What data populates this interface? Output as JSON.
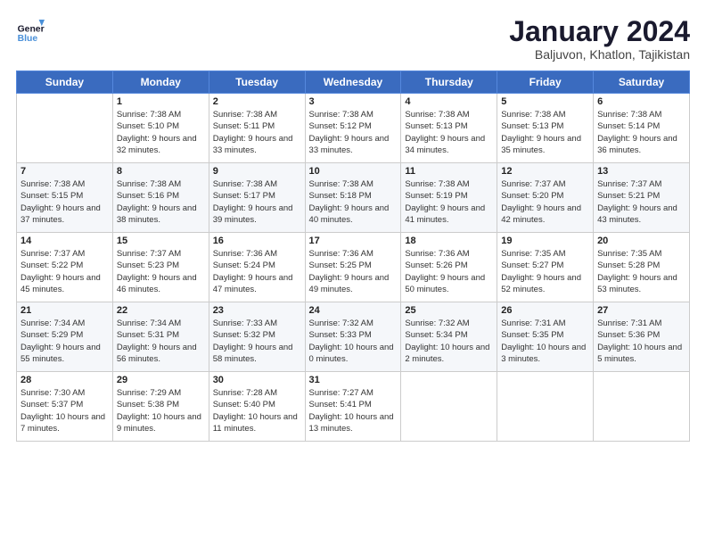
{
  "logo": {
    "line1": "General",
    "line2": "Blue"
  },
  "title": "January 2024",
  "subtitle": "Baljuvon, Khatlon, Tajikistan",
  "days_of_week": [
    "Sunday",
    "Monday",
    "Tuesday",
    "Wednesday",
    "Thursday",
    "Friday",
    "Saturday"
  ],
  "weeks": [
    [
      {
        "day": "",
        "sunrise": "",
        "sunset": "",
        "daylight": ""
      },
      {
        "day": "1",
        "sunrise": "Sunrise: 7:38 AM",
        "sunset": "Sunset: 5:10 PM",
        "daylight": "Daylight: 9 hours and 32 minutes."
      },
      {
        "day": "2",
        "sunrise": "Sunrise: 7:38 AM",
        "sunset": "Sunset: 5:11 PM",
        "daylight": "Daylight: 9 hours and 33 minutes."
      },
      {
        "day": "3",
        "sunrise": "Sunrise: 7:38 AM",
        "sunset": "Sunset: 5:12 PM",
        "daylight": "Daylight: 9 hours and 33 minutes."
      },
      {
        "day": "4",
        "sunrise": "Sunrise: 7:38 AM",
        "sunset": "Sunset: 5:13 PM",
        "daylight": "Daylight: 9 hours and 34 minutes."
      },
      {
        "day": "5",
        "sunrise": "Sunrise: 7:38 AM",
        "sunset": "Sunset: 5:13 PM",
        "daylight": "Daylight: 9 hours and 35 minutes."
      },
      {
        "day": "6",
        "sunrise": "Sunrise: 7:38 AM",
        "sunset": "Sunset: 5:14 PM",
        "daylight": "Daylight: 9 hours and 36 minutes."
      }
    ],
    [
      {
        "day": "7",
        "sunrise": "Sunrise: 7:38 AM",
        "sunset": "Sunset: 5:15 PM",
        "daylight": "Daylight: 9 hours and 37 minutes."
      },
      {
        "day": "8",
        "sunrise": "Sunrise: 7:38 AM",
        "sunset": "Sunset: 5:16 PM",
        "daylight": "Daylight: 9 hours and 38 minutes."
      },
      {
        "day": "9",
        "sunrise": "Sunrise: 7:38 AM",
        "sunset": "Sunset: 5:17 PM",
        "daylight": "Daylight: 9 hours and 39 minutes."
      },
      {
        "day": "10",
        "sunrise": "Sunrise: 7:38 AM",
        "sunset": "Sunset: 5:18 PM",
        "daylight": "Daylight: 9 hours and 40 minutes."
      },
      {
        "day": "11",
        "sunrise": "Sunrise: 7:38 AM",
        "sunset": "Sunset: 5:19 PM",
        "daylight": "Daylight: 9 hours and 41 minutes."
      },
      {
        "day": "12",
        "sunrise": "Sunrise: 7:37 AM",
        "sunset": "Sunset: 5:20 PM",
        "daylight": "Daylight: 9 hours and 42 minutes."
      },
      {
        "day": "13",
        "sunrise": "Sunrise: 7:37 AM",
        "sunset": "Sunset: 5:21 PM",
        "daylight": "Daylight: 9 hours and 43 minutes."
      }
    ],
    [
      {
        "day": "14",
        "sunrise": "Sunrise: 7:37 AM",
        "sunset": "Sunset: 5:22 PM",
        "daylight": "Daylight: 9 hours and 45 minutes."
      },
      {
        "day": "15",
        "sunrise": "Sunrise: 7:37 AM",
        "sunset": "Sunset: 5:23 PM",
        "daylight": "Daylight: 9 hours and 46 minutes."
      },
      {
        "day": "16",
        "sunrise": "Sunrise: 7:36 AM",
        "sunset": "Sunset: 5:24 PM",
        "daylight": "Daylight: 9 hours and 47 minutes."
      },
      {
        "day": "17",
        "sunrise": "Sunrise: 7:36 AM",
        "sunset": "Sunset: 5:25 PM",
        "daylight": "Daylight: 9 hours and 49 minutes."
      },
      {
        "day": "18",
        "sunrise": "Sunrise: 7:36 AM",
        "sunset": "Sunset: 5:26 PM",
        "daylight": "Daylight: 9 hours and 50 minutes."
      },
      {
        "day": "19",
        "sunrise": "Sunrise: 7:35 AM",
        "sunset": "Sunset: 5:27 PM",
        "daylight": "Daylight: 9 hours and 52 minutes."
      },
      {
        "day": "20",
        "sunrise": "Sunrise: 7:35 AM",
        "sunset": "Sunset: 5:28 PM",
        "daylight": "Daylight: 9 hours and 53 minutes."
      }
    ],
    [
      {
        "day": "21",
        "sunrise": "Sunrise: 7:34 AM",
        "sunset": "Sunset: 5:29 PM",
        "daylight": "Daylight: 9 hours and 55 minutes."
      },
      {
        "day": "22",
        "sunrise": "Sunrise: 7:34 AM",
        "sunset": "Sunset: 5:31 PM",
        "daylight": "Daylight: 9 hours and 56 minutes."
      },
      {
        "day": "23",
        "sunrise": "Sunrise: 7:33 AM",
        "sunset": "Sunset: 5:32 PM",
        "daylight": "Daylight: 9 hours and 58 minutes."
      },
      {
        "day": "24",
        "sunrise": "Sunrise: 7:32 AM",
        "sunset": "Sunset: 5:33 PM",
        "daylight": "Daylight: 10 hours and 0 minutes."
      },
      {
        "day": "25",
        "sunrise": "Sunrise: 7:32 AM",
        "sunset": "Sunset: 5:34 PM",
        "daylight": "Daylight: 10 hours and 2 minutes."
      },
      {
        "day": "26",
        "sunrise": "Sunrise: 7:31 AM",
        "sunset": "Sunset: 5:35 PM",
        "daylight": "Daylight: 10 hours and 3 minutes."
      },
      {
        "day": "27",
        "sunrise": "Sunrise: 7:31 AM",
        "sunset": "Sunset: 5:36 PM",
        "daylight": "Daylight: 10 hours and 5 minutes."
      }
    ],
    [
      {
        "day": "28",
        "sunrise": "Sunrise: 7:30 AM",
        "sunset": "Sunset: 5:37 PM",
        "daylight": "Daylight: 10 hours and 7 minutes."
      },
      {
        "day": "29",
        "sunrise": "Sunrise: 7:29 AM",
        "sunset": "Sunset: 5:38 PM",
        "daylight": "Daylight: 10 hours and 9 minutes."
      },
      {
        "day": "30",
        "sunrise": "Sunrise: 7:28 AM",
        "sunset": "Sunset: 5:40 PM",
        "daylight": "Daylight: 10 hours and 11 minutes."
      },
      {
        "day": "31",
        "sunrise": "Sunrise: 7:27 AM",
        "sunset": "Sunset: 5:41 PM",
        "daylight": "Daylight: 10 hours and 13 minutes."
      },
      {
        "day": "",
        "sunrise": "",
        "sunset": "",
        "daylight": ""
      },
      {
        "day": "",
        "sunrise": "",
        "sunset": "",
        "daylight": ""
      },
      {
        "day": "",
        "sunrise": "",
        "sunset": "",
        "daylight": ""
      }
    ]
  ]
}
